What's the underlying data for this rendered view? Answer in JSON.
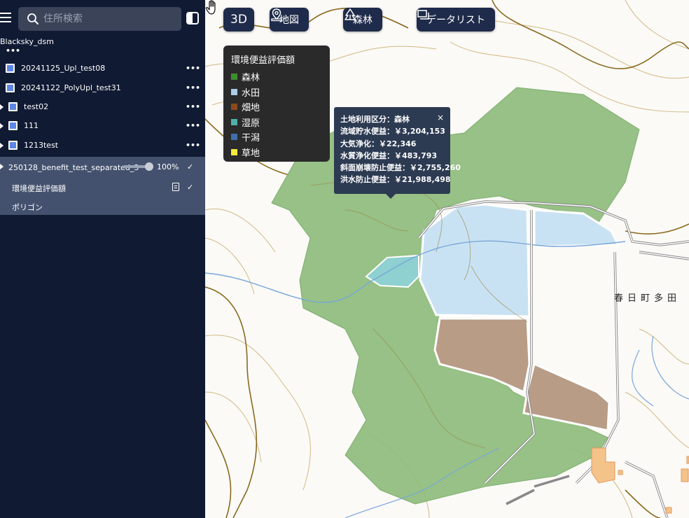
{
  "sidebar": {
    "search_placeholder": "住所検索",
    "group_title": "Blacksky_dsm",
    "more_label": "•••",
    "layers": [
      {
        "label": "20241125_Upl_test08",
        "checked": true,
        "expandable": false
      },
      {
        "label": "20241122_PolyUpl_test31",
        "checked": true,
        "expandable": false
      },
      {
        "label": "test02",
        "checked": true,
        "expandable": true
      },
      {
        "label": "111",
        "checked": true,
        "expandable": true
      },
      {
        "label": "1213test",
        "checked": true,
        "expandable": true
      }
    ],
    "active_layer": {
      "label": "250128_benefit_test_separated_3",
      "opacity": "100%",
      "opacity_fraction": 1.0,
      "check": "✓",
      "sublayers": [
        {
          "label": "環境便益評価額",
          "check": "✓"
        },
        {
          "label": "ポリゴン"
        }
      ]
    }
  },
  "toolbar": {
    "btn_3d": "3D",
    "btn_map": "地図",
    "btn_forest": "森林",
    "btn_datalist": "データリスト"
  },
  "legend": {
    "title": "環境便益評価額",
    "items": [
      {
        "label": "森林",
        "color": "#3f8e2e"
      },
      {
        "label": "水田",
        "color": "#a9cde8"
      },
      {
        "label": "畑地",
        "color": "#8b4a1d"
      },
      {
        "label": "湿原",
        "color": "#4fb0a8"
      },
      {
        "label": "干潟",
        "color": "#3f6fa8"
      },
      {
        "label": "草地",
        "color": "#f5ea3c"
      }
    ]
  },
  "popup": {
    "close": "×",
    "rows": [
      "土地利用区分：森林",
      "流域貯水便益：￥3,204,153",
      "大気浄化：￥22,346",
      "水質浄化便益：￥483,793",
      "斜面崩壊防止便益：￥2,755,260",
      "洪水防止便益：￥21,988,498"
    ]
  },
  "map": {
    "town_label": "春日町多田",
    "colors": {
      "forest": "#8ebc7c",
      "paddy": "#c9e2f3",
      "field": "#b89c86",
      "wetland": "#8fd0d0",
      "contour": "#c9a96a",
      "contour_index": "#8a6a1f",
      "road": "#7a7a7a",
      "stream": "#7aa6d8",
      "building": "#f3c389"
    }
  }
}
